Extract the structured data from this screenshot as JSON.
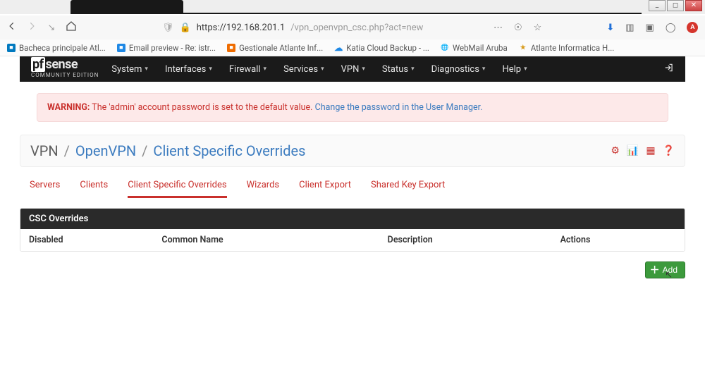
{
  "browser": {
    "url_host": "https://192.168.201.1",
    "url_rest": "/vpn_openvpn_csc.php?act=new"
  },
  "bookmarks": [
    {
      "icon": "trello",
      "label": "Bacheca principale Atl..."
    },
    {
      "icon": "blue",
      "label": "Email preview - Re: istr..."
    },
    {
      "icon": "orange",
      "label": "Gestionale Atlante Inf..."
    },
    {
      "icon": "cloud",
      "label": "Katia Cloud Backup - ..."
    },
    {
      "icon": "globe",
      "label": "WebMail Aruba"
    },
    {
      "icon": "star",
      "label": "Atlante Informatica H..."
    }
  ],
  "logo": {
    "line1_pf": "pf",
    "line1_sense": "sense",
    "line2": "COMMUNITY EDITION"
  },
  "menus": [
    "System",
    "Interfaces",
    "Firewall",
    "Services",
    "VPN",
    "Status",
    "Diagnostics",
    "Help"
  ],
  "warning": {
    "label": "WARNING:",
    "text": "The 'admin' account password is set to the default value.",
    "link": "Change the password in the User Manager."
  },
  "breadcrumb": {
    "c1": "VPN",
    "c2": "OpenVPN",
    "c3": "Client Specific Overrides"
  },
  "tabs": [
    "Servers",
    "Clients",
    "Client Specific Overrides",
    "Wizards",
    "Client Export",
    "Shared Key Export"
  ],
  "active_tab_index": 2,
  "panel": {
    "title": "CSC Overrides",
    "columns": [
      "Disabled",
      "Common Name",
      "Description",
      "Actions"
    ]
  },
  "add_button": "Add"
}
